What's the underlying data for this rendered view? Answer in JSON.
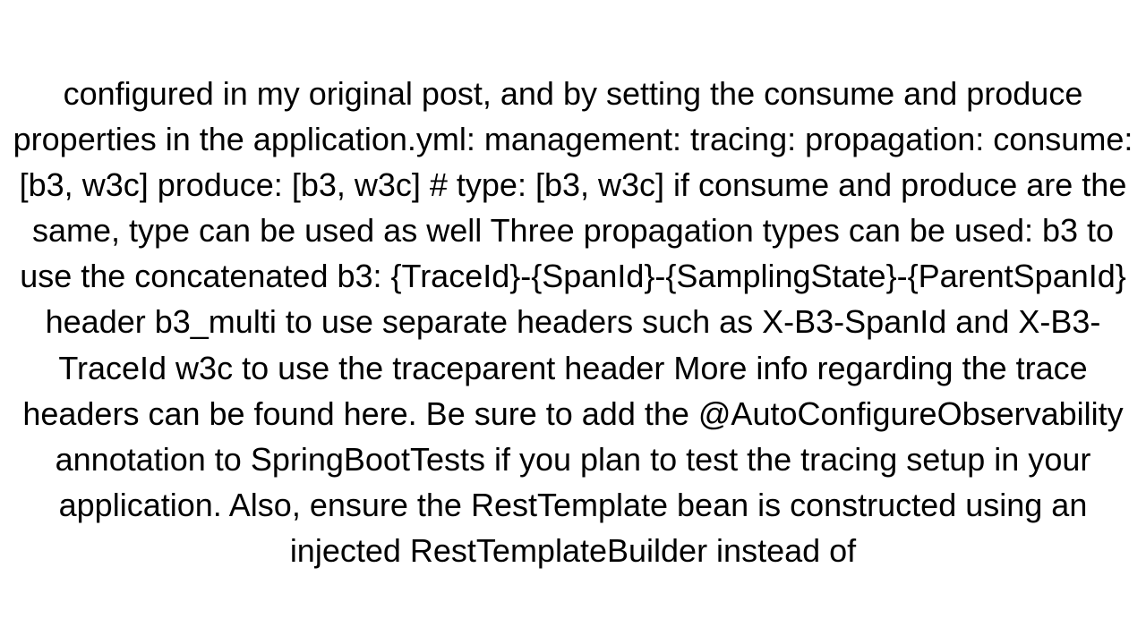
{
  "document": {
    "body_text": "configured in my original post, and by setting the consume and produce properties in the application.yml: management:   tracing:     propagation:       consume: [b3, w3c]       produce: [b3, w3c]       # type: [b3, w3c] if consume and produce are the same, type can be used as well  Three propagation types can be used:  b3 to use the concatenated b3: {TraceId}-{SpanId}-{SamplingState}-{ParentSpanId} header b3_multi to use separate headers such as X-B3-SpanId and X-B3-TraceId w3c to use the traceparent header  More info regarding the trace headers can be found here. Be sure to add the @AutoConfigureObservability annotation to SpringBootTests if you plan to test the tracing setup in your application. Also, ensure the RestTemplate bean is constructed using an injected RestTemplateBuilder instead of"
  }
}
